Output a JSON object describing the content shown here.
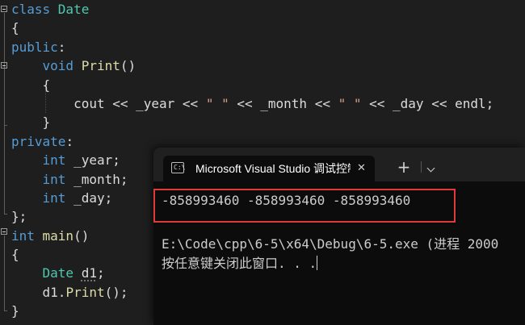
{
  "editor": {
    "lines": [
      {
        "segs": [
          {
            "t": "class ",
            "c": "kw"
          },
          {
            "t": "Date",
            "c": "cls"
          }
        ]
      },
      {
        "segs": [
          {
            "t": "{",
            "c": "var"
          }
        ]
      },
      {
        "segs": [
          {
            "t": "public",
            "c": "kw"
          },
          {
            "t": ":",
            "c": "var"
          }
        ]
      },
      {
        "segs": [
          {
            "t": "    ",
            "c": "var"
          },
          {
            "t": "void ",
            "c": "kw"
          },
          {
            "t": "Print",
            "c": "fn"
          },
          {
            "t": "()",
            "c": "var"
          }
        ]
      },
      {
        "segs": [
          {
            "t": "    {",
            "c": "var"
          }
        ]
      },
      {
        "segs": [
          {
            "t": "        cout << _year << ",
            "c": "var"
          },
          {
            "t": "\" \"",
            "c": "str"
          },
          {
            "t": " << _month << ",
            "c": "var"
          },
          {
            "t": "\" \"",
            "c": "str"
          },
          {
            "t": " << _day << endl;",
            "c": "var"
          }
        ]
      },
      {
        "segs": [
          {
            "t": "    }",
            "c": "var"
          }
        ]
      },
      {
        "segs": [
          {
            "t": "private",
            "c": "kw"
          },
          {
            "t": ":",
            "c": "var"
          }
        ]
      },
      {
        "segs": [
          {
            "t": "    ",
            "c": "var"
          },
          {
            "t": "int ",
            "c": "kw"
          },
          {
            "t": "_year;",
            "c": "var"
          }
        ]
      },
      {
        "segs": [
          {
            "t": "    ",
            "c": "var"
          },
          {
            "t": "int ",
            "c": "kw"
          },
          {
            "t": "_month;",
            "c": "var"
          }
        ]
      },
      {
        "segs": [
          {
            "t": "    ",
            "c": "var"
          },
          {
            "t": "int ",
            "c": "kw"
          },
          {
            "t": "_day;",
            "c": "var"
          }
        ]
      },
      {
        "segs": [
          {
            "t": "};",
            "c": "var"
          }
        ]
      },
      {
        "segs": [
          {
            "t": "int ",
            "c": "kw"
          },
          {
            "t": "main",
            "c": "fn"
          },
          {
            "t": "()",
            "c": "var"
          }
        ]
      },
      {
        "segs": [
          {
            "t": "{",
            "c": "var"
          }
        ]
      },
      {
        "segs": [
          {
            "t": "    ",
            "c": "var"
          },
          {
            "t": "Date ",
            "c": "cls"
          },
          {
            "t": "d1",
            "c": "var squig"
          },
          {
            "t": ";",
            "c": "var"
          }
        ]
      },
      {
        "segs": [
          {
            "t": "    d1.",
            "c": "var"
          },
          {
            "t": "Print",
            "c": "fn"
          },
          {
            "t": "();",
            "c": "var"
          }
        ]
      },
      {
        "segs": [
          {
            "t": "}",
            "c": "var"
          }
        ]
      }
    ]
  },
  "terminal": {
    "tab_title": "Microsoft Visual Studio 调试控制台",
    "tab_icon_text": "C:\\",
    "close_glyph": "✕",
    "new_tab_glyph": "+",
    "output": "-858993460 -858993460 -858993460",
    "exit_line": "E:\\Code\\cpp\\6-5\\x64\\Debug\\6-5.exe (进程 2000",
    "prompt_line": "按任意键关闭此窗口. . ."
  },
  "colors": {
    "editor_bg": "#1e1e1e",
    "keyword": "#569cd6",
    "class_name": "#4ec9b0",
    "function": "#dcdcaa",
    "string": "#d69d85",
    "highlight_box": "#e03a3a"
  }
}
